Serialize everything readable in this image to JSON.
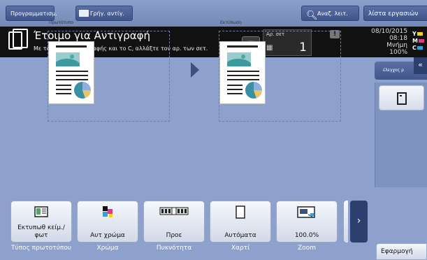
{
  "topbar": {
    "programs_label": "Προγραμματισμ.",
    "quick_copy_label": "Γρήγ. αντίγ.",
    "search_label": "Αναζ. λειτ.",
    "job_list_label": "λίστα εργασιών"
  },
  "status": {
    "title": "Έτοιμο για Αντιγραφή",
    "message": "Με το πληκτρολόγιο αφής και το C, αλλάξτε τον αρ. των σετ.",
    "copies_label": "Αρ. σετ",
    "copies_value": "1",
    "date": "08/10/2015",
    "time": "08:18",
    "memory_label": "Μνήμη",
    "memory_value": "100%",
    "toner": [
      {
        "letter": "Y",
        "color": "#f2d21a"
      },
      {
        "letter": "M",
        "color": "#e0398c"
      },
      {
        "letter": "C",
        "color": "#2aa3dc"
      }
    ]
  },
  "preview": {
    "original_label": "Πρωτότυπο",
    "output_label": "Εκτύπωση"
  },
  "side": {
    "check_label": "έλεγχος ρ"
  },
  "functions": [
    {
      "value": "Εκτυπωθ κείμ./φωτ",
      "label": "Τύπος πρωτοτύπου"
    },
    {
      "value": "Αυτ χρώμα",
      "label": "Χρώμα"
    },
    {
      "value": "Προε",
      "label": "Πυκνότητα"
    },
    {
      "value": "Αυτόματα",
      "label": "Χαρτί"
    },
    {
      "value": "100.0%",
      "label": "Zoom"
    }
  ],
  "apply_label": "Εφαρμογή",
  "colors": {
    "background": "#8da1cc",
    "header": "#111111",
    "button_dark": "#3f5488"
  }
}
